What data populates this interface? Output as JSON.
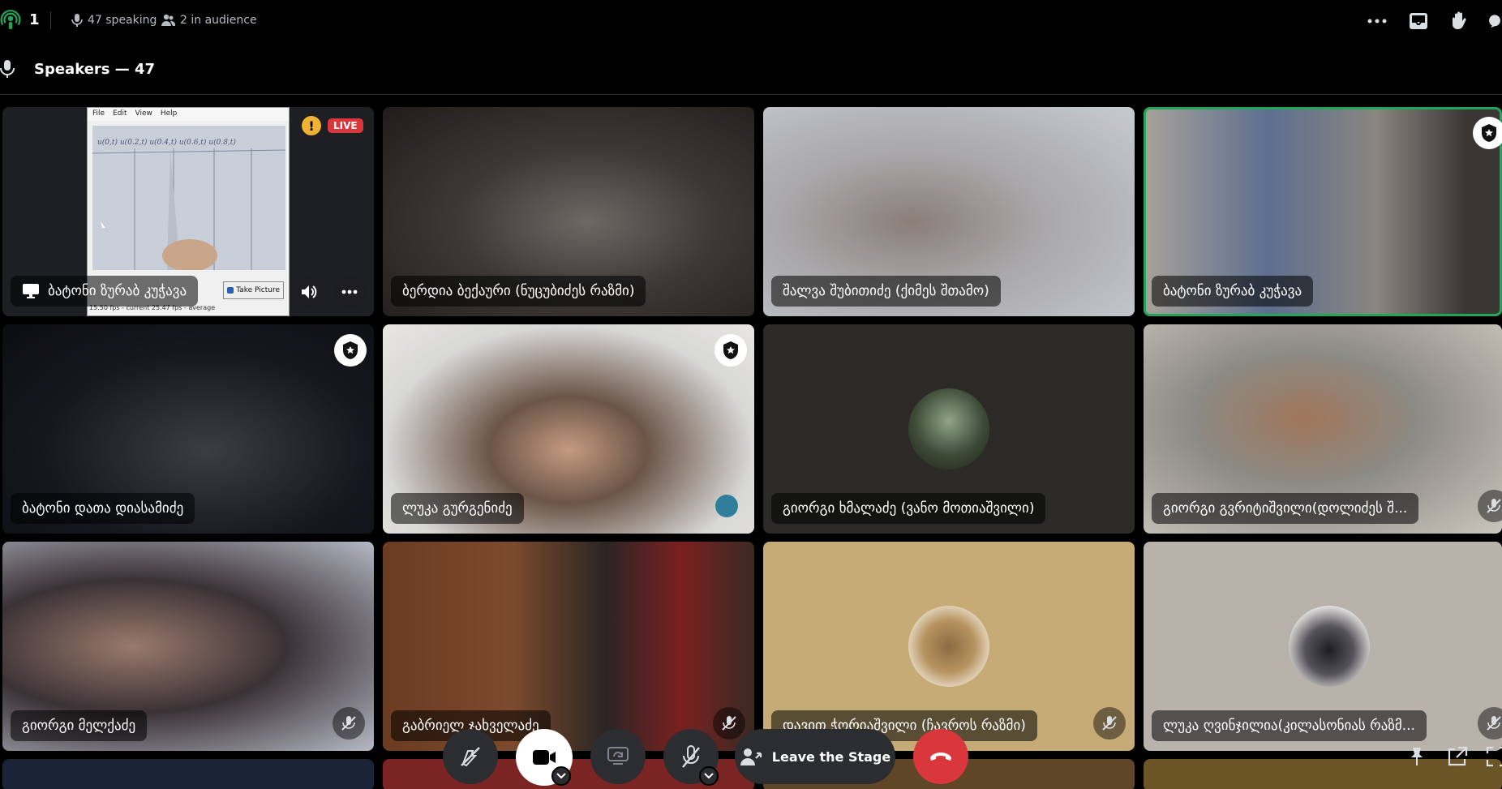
{
  "topbar": {
    "stage_count": "1",
    "speaking": "47 speaking",
    "audience": "2 in audience",
    "icons": [
      "stage-icon",
      "mic-icon",
      "audience-icon",
      "more-icon",
      "inbox-icon",
      "raise-hand-icon",
      "help-icon"
    ]
  },
  "section": {
    "title": "Speakers — 47"
  },
  "tiles": [
    {
      "name": "ბატონი ზურაბ კუჭავა",
      "type": "stream"
    },
    {
      "name": "ბერდია ბექაური (ნუცუბიძეს რაზმი)",
      "type": "video"
    },
    {
      "name": "შალვა შუბითიძე (ქიმეს შთამო)",
      "type": "video"
    },
    {
      "name": "ბატონი ზურაბ კუჭავა",
      "type": "video",
      "speaking": true
    },
    {
      "name": "ბატონი დათა დიასამიძე",
      "type": "video"
    },
    {
      "name": "ლუკა გურგენიძე",
      "type": "video"
    },
    {
      "name": "გიორგი ხმალაძე (ვანო მოთიაშვილი)",
      "type": "avatar"
    },
    {
      "name": "გიორგი გვრიტიშვილი(დოლიძეს შ...",
      "type": "video",
      "muted": true
    },
    {
      "name": "გიორგი მელქაძე",
      "type": "video",
      "muted": true
    },
    {
      "name": "გაბრიელ ჯახველაძე",
      "type": "video",
      "muted": true
    },
    {
      "name": "დავით ჭორიაშვილი (ჩავროს რაზმი)",
      "type": "avatar",
      "muted": true
    },
    {
      "name": "ლუკა ღვინჯილია(კილასონიას რაზმ...",
      "type": "avatar",
      "muted": true
    }
  ],
  "stream": {
    "live_label": "LIVE",
    "warning": "!",
    "menu": [
      "File",
      "Edit",
      "View",
      "Help"
    ],
    "take_picture": "Take Picture",
    "fps": "15.50 fps - current     25.47 fps - average",
    "formula": "u(0,t)  u(0.2,t)  u(0.4,t)  u(0.6,t)  u(0.8,t)"
  },
  "controls": {
    "leave_label": "Leave the Stage",
    "icons": [
      "mute-video-icon",
      "camera-icon",
      "screen-share-icon",
      "mic-muted-icon",
      "leave-stage-icon",
      "disconnect-icon",
      "pin-icon",
      "popout-icon",
      "fullscreen-icon"
    ]
  },
  "colors": {
    "live": "#da373c",
    "speaking_outline": "#23a559",
    "disconnect": "#da373c",
    "stage_green": "#23a559",
    "panel": "#2b2d31"
  }
}
